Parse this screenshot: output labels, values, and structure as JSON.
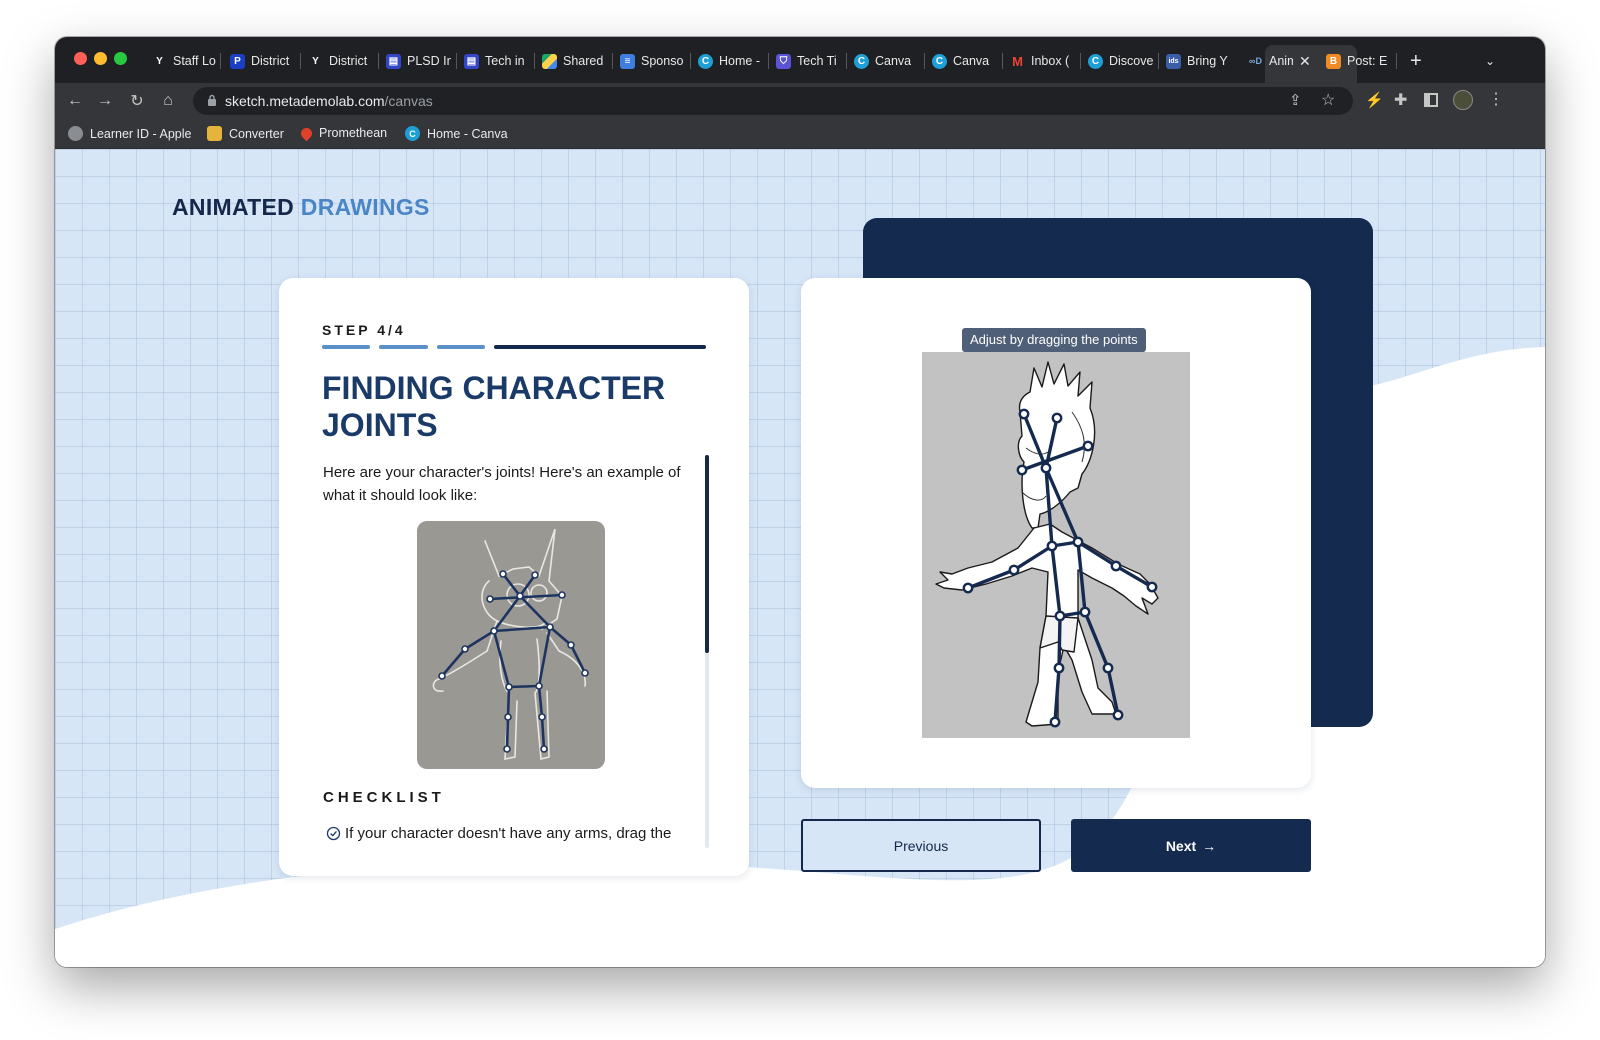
{
  "browser": {
    "tabs": [
      {
        "label": "Staff Lo",
        "icon": "yahoo-icon",
        "color": "#1f2023"
      },
      {
        "label": "District",
        "icon": "paypal-icon",
        "color": "#1a3fc4"
      },
      {
        "label": "District",
        "icon": "yahoo-icon",
        "color": "#1f2023"
      },
      {
        "label": "PLSD In",
        "icon": "form-icon",
        "color": "#3346c7"
      },
      {
        "label": "Tech in",
        "icon": "form-icon",
        "color": "#3346c7"
      },
      {
        "label": "Shared",
        "icon": "drive-icon",
        "color": "#1f2023"
      },
      {
        "label": "Sponso",
        "icon": "docs-icon",
        "color": "#3f7de0"
      },
      {
        "label": "Home -",
        "icon": "canva-icon",
        "color": "#1e9fd6"
      },
      {
        "label": "Tech Ti",
        "icon": "shield-icon",
        "color": "#5a53d6"
      },
      {
        "label": "Canva",
        "icon": "canva-icon",
        "color": "#1e9fd6"
      },
      {
        "label": "Canva",
        "icon": "canva-icon",
        "color": "#1e9fd6"
      },
      {
        "label": "Inbox (",
        "icon": "gmail-icon",
        "color": "#1f2023"
      },
      {
        "label": "Discove",
        "icon": "canva-icon",
        "color": "#1e9fd6"
      },
      {
        "label": "Bring Y",
        "icon": "ids-icon",
        "color": "#3a5da8"
      },
      {
        "label": "Anim",
        "icon": "meta-icon",
        "color": "#35363a"
      },
      {
        "label": "Post: E",
        "icon": "blogger-icon",
        "color": "#f08a24"
      }
    ],
    "url_host": "sketch.metademolab.com",
    "url_path": "/canvas",
    "bookmarks": [
      {
        "label": "Learner ID - Apple",
        "icon": "apple-icon"
      },
      {
        "label": "Converter",
        "icon": "converter-icon"
      },
      {
        "label": "Promethean",
        "icon": "promethean-icon"
      },
      {
        "label": "Home - Canva",
        "icon": "canva-icon"
      }
    ]
  },
  "page": {
    "brand_part1": "ANIMATED",
    "brand_part2": "DRAWINGS",
    "step_label": "STEP 4/4",
    "progress": {
      "current_step": 4,
      "total_steps": 4
    },
    "heading": "FINDING CHARACTER JOINTS",
    "description": "Here are your character's joints! Here's an example of what it should look like:",
    "checklist_title": "CHECKLIST",
    "checklist_item": "If your character doesn't have any arms, drag the",
    "tooltip": "Adjust by dragging the points",
    "previous_label": "Previous",
    "next_label": "Next",
    "next_icon": "arrow-right-icon",
    "colors": {
      "navy": "#142a4e",
      "accent": "#4a86c5",
      "background": "#d6e6f7"
    }
  }
}
